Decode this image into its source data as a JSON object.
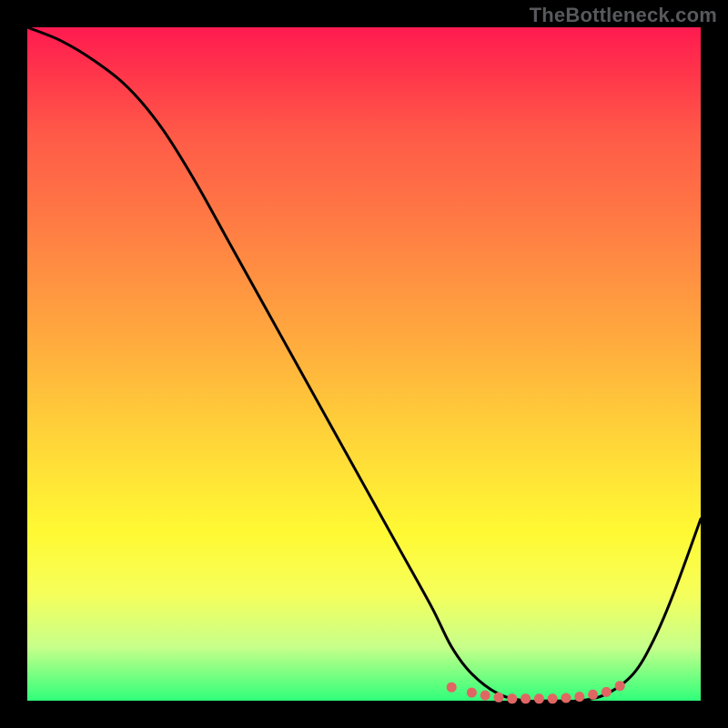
{
  "watermark": "TheBottleneck.com",
  "chart_data": {
    "type": "line",
    "title": "",
    "xlabel": "",
    "ylabel": "",
    "xlim": [
      0,
      100
    ],
    "ylim": [
      0,
      100
    ],
    "series": [
      {
        "name": "bottleneck-curve",
        "x": [
          0,
          5,
          10,
          15,
          20,
          25,
          30,
          35,
          40,
          45,
          50,
          55,
          60,
          63,
          66,
          70,
          74,
          78,
          82,
          86,
          90,
          93,
          96,
          100
        ],
        "y": [
          100,
          98,
          95,
          91,
          85,
          77,
          68,
          59,
          50,
          41,
          32,
          23,
          14,
          8,
          4,
          1,
          0,
          0,
          0,
          1,
          4,
          9,
          16,
          27
        ]
      },
      {
        "name": "optimal-zone-markers",
        "x": [
          63,
          66,
          68,
          70,
          72,
          74,
          76,
          78,
          80,
          82,
          84,
          86,
          88
        ],
        "y": [
          2,
          1.2,
          0.8,
          0.5,
          0.3,
          0.3,
          0.3,
          0.3,
          0.4,
          0.6,
          0.9,
          1.3,
          2.2
        ]
      }
    ],
    "colors": {
      "curve": "#000000",
      "markers": "#e06663",
      "gradient_top": "#ff1a50",
      "gradient_bottom": "#2fff7a"
    }
  }
}
